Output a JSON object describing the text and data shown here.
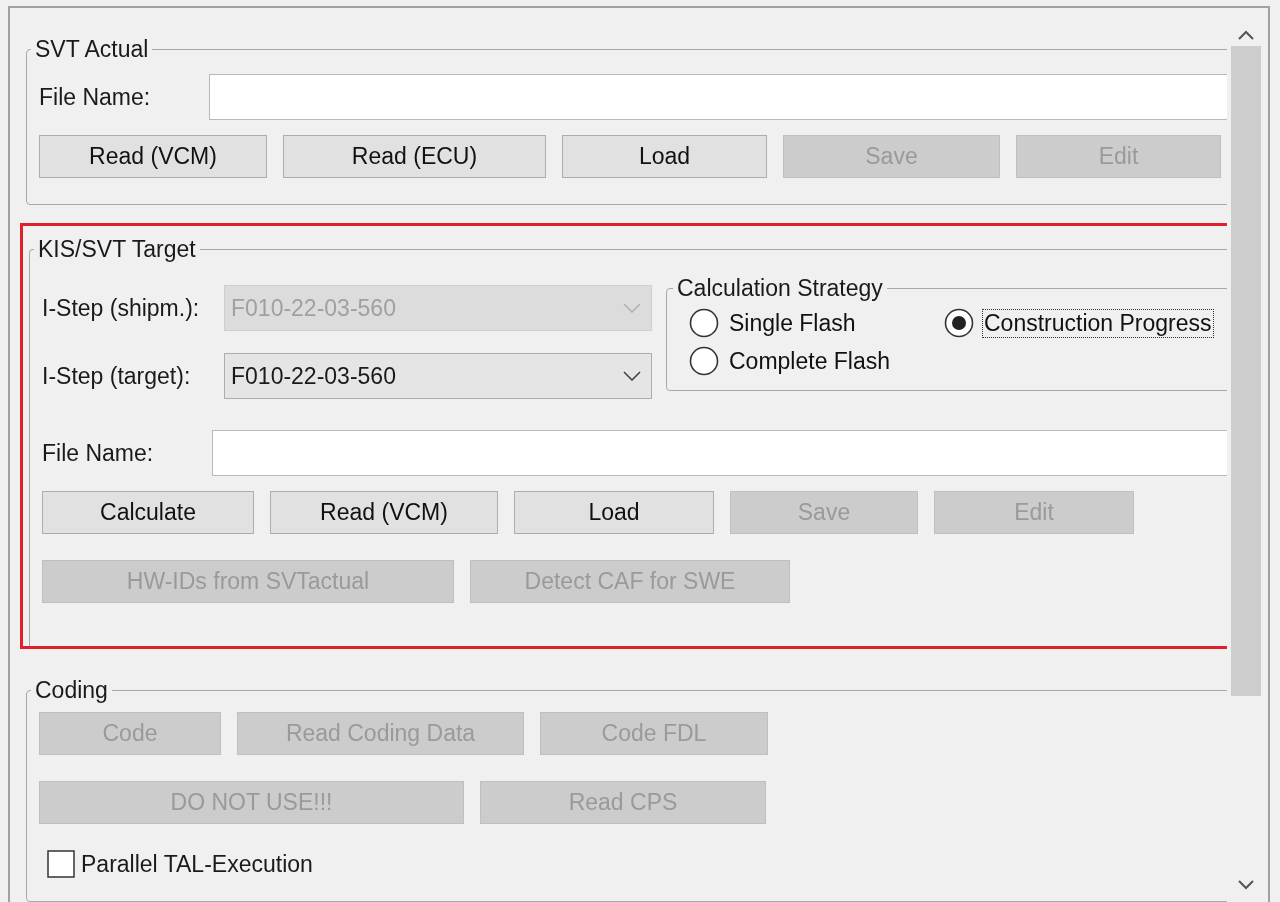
{
  "svt_actual": {
    "title": "SVT Actual",
    "file_name_label": "File Name:",
    "buttons": [
      {
        "label": "Read (VCM)",
        "disabled": false
      },
      {
        "label": "Read (ECU)",
        "disabled": false
      },
      {
        "label": "Load",
        "disabled": false
      },
      {
        "label": "Save",
        "disabled": true
      },
      {
        "label": "Edit",
        "disabled": true
      }
    ]
  },
  "kis_svt_target": {
    "title": "KIS/SVT Target",
    "highlighted": true,
    "istep_shipm": {
      "label": "I-Step (shipm.):",
      "value": "F010-22-03-560",
      "disabled": true
    },
    "istep_target": {
      "label": "I-Step (target):",
      "value": "F010-22-03-560",
      "disabled": false
    },
    "calculation_strategy": {
      "title": "Calculation Strategy",
      "options": [
        {
          "label": "Single Flash",
          "selected": false
        },
        {
          "label": "Construction Progress",
          "selected": true
        },
        {
          "label": "Complete Flash",
          "selected": false
        }
      ]
    },
    "file_name_label": "File Name:",
    "button_rows": [
      [
        {
          "label": "Calculate",
          "disabled": false
        },
        {
          "label": "Read (VCM)",
          "disabled": false
        },
        {
          "label": "Load",
          "disabled": false
        },
        {
          "label": "Save",
          "disabled": true
        },
        {
          "label": "Edit",
          "disabled": true
        }
      ],
      [
        {
          "label": "HW-IDs from SVTactual",
          "disabled": true
        },
        {
          "label": "Detect CAF for SWE",
          "disabled": true
        }
      ]
    ]
  },
  "coding": {
    "title": "Coding",
    "button_rows": [
      [
        {
          "label": "Code",
          "disabled": true
        },
        {
          "label": "Read Coding Data",
          "disabled": true
        },
        {
          "label": "Code FDL",
          "disabled": true
        }
      ],
      [
        {
          "label": "DO NOT USE!!!",
          "disabled": true
        },
        {
          "label": "Read CPS",
          "disabled": true
        }
      ]
    ],
    "checkbox": {
      "label": "Parallel TAL-Execution",
      "checked": false
    }
  }
}
